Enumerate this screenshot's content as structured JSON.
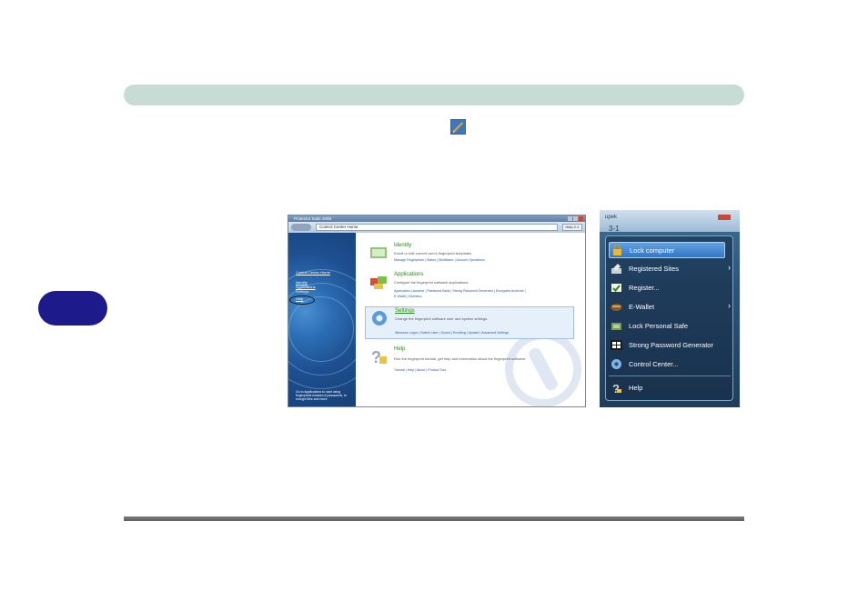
{
  "cc": {
    "title": "Protector Suite 2009",
    "address": "Control Center Home",
    "help_button": "Help 2-1",
    "sidebar": {
      "home": "Control Center Home",
      "identity": "Identity",
      "applications": "Applications",
      "settings": "Settings",
      "help": "Help",
      "note": "Go to Applications to start using fingerprints instead of passwords, to encrypt files and more."
    },
    "sections": [
      {
        "title": "Identity",
        "desc": "Enroll or edit current user's fingerprint templates.",
        "links": "Manage Fingerprints | Status | Multifactor | Account Operations"
      },
      {
        "title": "Applications",
        "desc": "Configure the fingerprint software applications.",
        "links": "Application Launcher | Password Bank | Strong Password Generator | Encrypted Archives |",
        "links2": "E-Wallet | Biomenu"
      },
      {
        "title": "Settings",
        "desc": "Change the fingerprint software user and system settings.",
        "links": "Windows Logon | Switch User | Sound | Enrolling | Update | Advanced Settings"
      },
      {
        "title": "Help",
        "desc": "Run the fingerprint tutorial, get help and information about the fingerprint software.",
        "links": "Tutorial | Help | About | Product Tour"
      }
    ]
  },
  "startmenu": {
    "brand": "upek",
    "user": "3-1",
    "items": [
      {
        "label": "Lock computer",
        "icon": "lock-icon"
      },
      {
        "label": "Registered Sites",
        "icon": "registered-sites-icon"
      },
      {
        "label": "Register...",
        "icon": "register-icon"
      },
      {
        "label": "E-Wallet",
        "icon": "wallet-icon"
      },
      {
        "label": "Lock Personal Safe",
        "icon": "personal-safe-icon"
      },
      {
        "label": "Strong Password Generator",
        "icon": "password-generator-icon"
      },
      {
        "label": "Control Center...",
        "icon": "gear-icon"
      },
      {
        "label": "Help",
        "icon": "help-icon"
      }
    ]
  },
  "colors": {
    "header_bar": "#c6dcd4",
    "chapter_tab": "#1d1b8c",
    "accent_green": "#2d8a1a",
    "menu_highlight": "#3376c6"
  }
}
